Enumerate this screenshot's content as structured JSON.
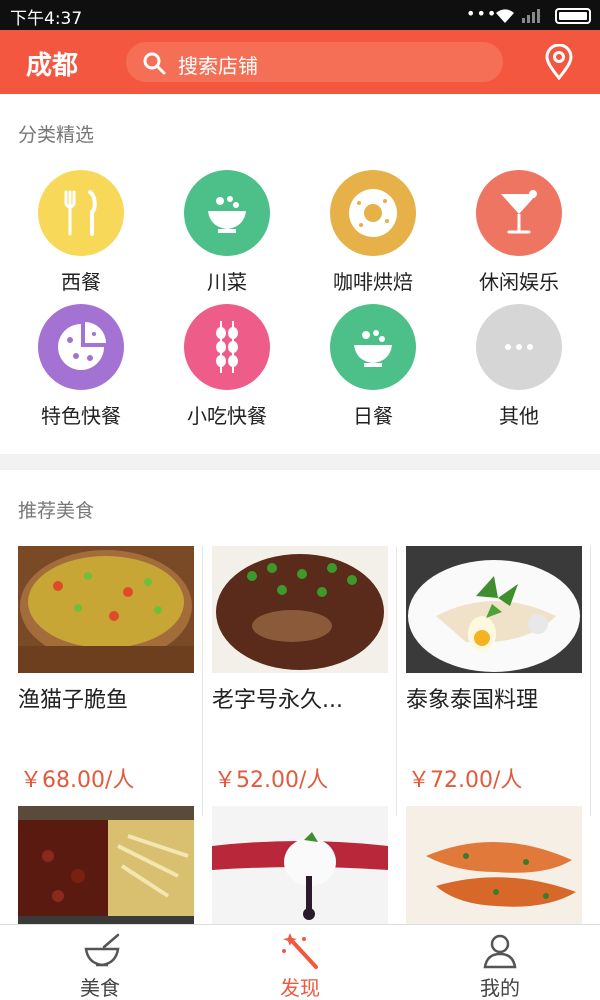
{
  "status_bar": {
    "time": "下午4:37",
    "dots": "•••"
  },
  "header": {
    "city": "成都",
    "search_placeholder": "搜索店铺"
  },
  "categories": {
    "title": "分类精选",
    "items": [
      {
        "label": "西餐",
        "icon": "fork-knife-icon",
        "color": "#f7d858"
      },
      {
        "label": "川菜",
        "icon": "bowl-icon",
        "color": "#4dc08a"
      },
      {
        "label": "咖啡烘焙",
        "icon": "donut-icon",
        "color": "#e5b148"
      },
      {
        "label": "休闲娱乐",
        "icon": "cocktail-icon",
        "color": "#ef7563"
      },
      {
        "label": "特色快餐",
        "icon": "pizza-icon",
        "color": "#a472d3"
      },
      {
        "label": "小吃快餐",
        "icon": "skewer-icon",
        "color": "#ee5c8a"
      },
      {
        "label": "日餐",
        "icon": "bowl-icon",
        "color": "#4dc08a"
      },
      {
        "label": "其他",
        "icon": "more-icon",
        "color": "#d6d6d6"
      }
    ]
  },
  "recommended": {
    "title": "推荐美食",
    "items": [
      {
        "name": "渔猫子脆鱼",
        "price": "￥68.00/人"
      },
      {
        "name": "老字号永久...",
        "price": "￥52.00/人"
      },
      {
        "name": "泰象泰国料理",
        "price": "￥72.00/人"
      },
      {
        "name": "",
        "price": ""
      },
      {
        "name": "",
        "price": ""
      },
      {
        "name": "",
        "price": ""
      }
    ]
  },
  "bottom_nav": {
    "tabs": [
      {
        "label": "美食",
        "icon": "bowl-icon"
      },
      {
        "label": "发现",
        "icon": "magic-wand-icon"
      },
      {
        "label": "我的",
        "icon": "person-icon"
      }
    ],
    "active": "发现",
    "accent": "#f3573f"
  }
}
